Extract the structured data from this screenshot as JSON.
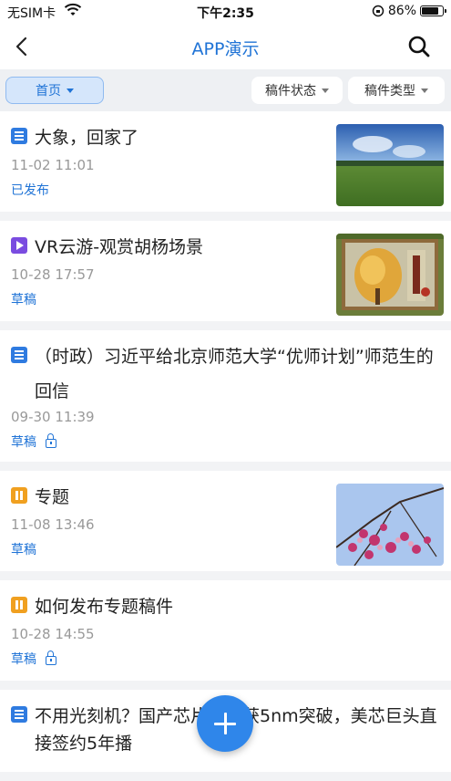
{
  "status_bar": {
    "carrier": "无SIM卡",
    "time": "下午2:35",
    "battery_percent": "86%",
    "battery_level": 0.86
  },
  "nav": {
    "title": "APP演示"
  },
  "filters": {
    "home": "首页",
    "status": "稿件状态",
    "type": "稿件类型"
  },
  "items": [
    {
      "type_icon": "article-icon",
      "title": "大象，回家了",
      "date": "11-02 11:01",
      "state": "已发布",
      "locked": false,
      "thumb": "grassland-photo"
    },
    {
      "type_icon": "video-icon",
      "title": "VR云游-观赏胡杨场景",
      "date": "10-28 17:57",
      "state": "草稿",
      "locked": false,
      "thumb": "poplar-poster"
    },
    {
      "type_icon": "article-icon",
      "title": "（时政）习近平给北京师范大学“优师计划”师范生的回信",
      "date": "09-30 11:39",
      "state": "草稿",
      "locked": true,
      "thumb": null
    },
    {
      "type_icon": "topic-icon",
      "title": "专题",
      "date": "11-08 13:46",
      "state": "草稿",
      "locked": false,
      "thumb": "blossom-photo"
    },
    {
      "type_icon": "topic-icon",
      "title": "如何发布专题稿件",
      "date": "10-28 14:55",
      "state": "草稿",
      "locked": true,
      "thumb": null
    },
    {
      "type_icon": "article-icon",
      "title": "不用光刻机？国产芯片技术获5nm突破，美芯巨头直接签约5年播",
      "date": "",
      "state": "",
      "locked": false,
      "thumb": null
    }
  ],
  "colors": {
    "accent": "#1f73d6",
    "fab": "#2f86ea",
    "background": "#f2f3f5"
  }
}
